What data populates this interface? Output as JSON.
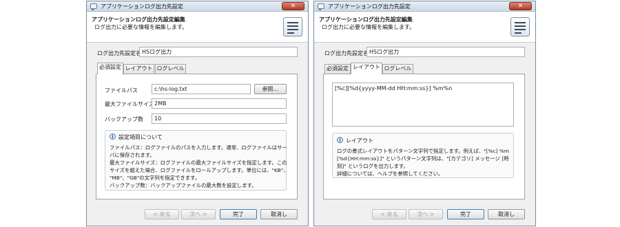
{
  "windows": [
    {
      "title": "アプリケーションログ出力先設定",
      "close_glyph": "✕",
      "header": {
        "title": "アプリケーションログ出力先設定編集",
        "subtitle": "ログ出力に必要な情報を編集します。",
        "icon": "document-list-icon"
      },
      "name_label": "ログ出力先設定名",
      "name_value": "HSログ出力",
      "tabs": [
        "必須設定",
        "レイアウト",
        "ログレベル"
      ],
      "active_tab": "必須設定",
      "fields": {
        "file_path_label": "ファイルパス",
        "file_path_value": "c:\\hs-log.txt",
        "browse_button": "参照...",
        "max_size_label": "最大ファイルサイズ",
        "max_size_value": "2MB",
        "backup_label": "バックアップ数",
        "backup_value": "10"
      },
      "info": {
        "title": "設定項目について",
        "lines": [
          "ファイルパス：ログファイルのパスを入力します。通常、ログファイルはサー",
          "バに保存されます。",
          "最大ファイルサイズ：ログファイルの最大ファイルサイズを指定します。この",
          "サイズを超えた場合、ログファイルをロールアップします。単位には、\"KB\"、",
          "\"MB\"、\"GB\"の文字列を指定できます。",
          "バックアップ数：バックアップファイルの最大数を設定します。"
        ]
      },
      "buttons": {
        "back": "< 戻る",
        "next": "次へ >",
        "finish": "完了",
        "cancel": "取消し"
      }
    },
    {
      "title": "アプリケーションログ出力先設定",
      "close_glyph": "✕",
      "header": {
        "title": "アプリケーションログ出力先設定編集",
        "subtitle": "ログ出力に必要な情報を編集します。",
        "icon": "document-list-icon"
      },
      "name_label": "ログ出力先設定名",
      "name_value": "HSログ出力",
      "tabs": [
        "必須設定",
        "レイアウト",
        "ログレベル"
      ],
      "active_tab": "レイアウト",
      "layout_pattern": "[%c][%d{yyyy-MM-dd HH:mm:ss}] %m%n",
      "info": {
        "title": "レイアウト",
        "lines": [
          "ログの書式レイアウトをパターン文字列で指定します。例えば、\"[%c] %m",
          "[%d{HH:mm:ss}]\" というパターン文字列は、\"[カテゴリ] メッセージ [時",
          "刻]\" というログを出力します。",
          "詳細については、ヘルプを参照してください。"
        ]
      },
      "buttons": {
        "back": "< 戻る",
        "next": "次へ >",
        "finish": "完了",
        "cancel": "取消し"
      }
    }
  ]
}
